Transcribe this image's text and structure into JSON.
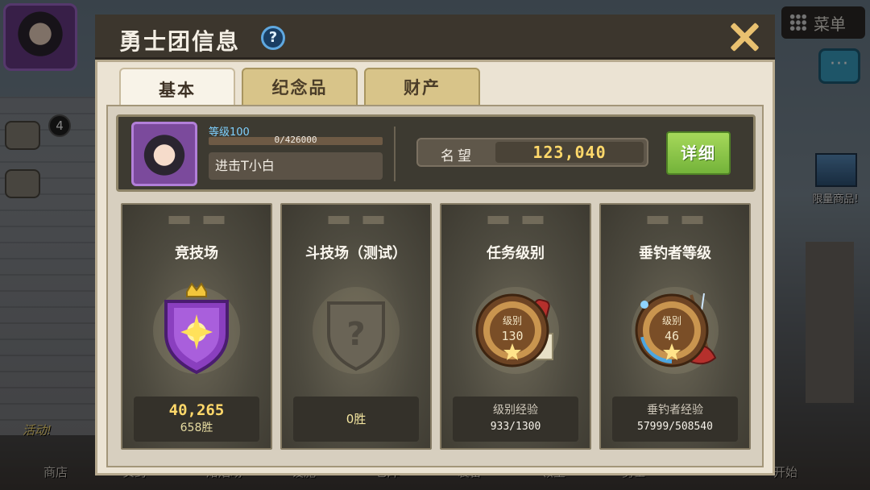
{
  "background": {
    "menu_label": "菜单",
    "shop_label": "限量商品!",
    "event_label": "活动!",
    "badge_count": "4",
    "dock": [
      "商店",
      "实药",
      "熔焰场",
      "设施",
      "仓库",
      "装备",
      "领主",
      "勇士",
      "开始"
    ]
  },
  "dialog": {
    "title": "勇士团信息",
    "help_icon": "?",
    "tabs": [
      {
        "label": "基本",
        "active": true
      },
      {
        "label": "纪念品",
        "active": false
      },
      {
        "label": "财产",
        "active": false
      }
    ]
  },
  "profile": {
    "level_label": "等级100",
    "xp_text": "0/426000",
    "xp_progress": 0,
    "name": "进击T小白",
    "fame_label": "名望",
    "fame_value": "123,040",
    "detail_button": "详细"
  },
  "cards": [
    {
      "title": "竞技场",
      "icon": "purple-shield-crown-icon",
      "main": "40,265",
      "sub": "658胜"
    },
    {
      "title": "斗技场（测试）",
      "icon": "locked-shield-question-icon",
      "center": "0胜"
    },
    {
      "title": "任务级别",
      "icon": "quest-level-medal-icon",
      "medal_label": "级别",
      "medal_value": "130",
      "stat_label": "级别经验",
      "stat_value": "933/1300"
    },
    {
      "title": "垂钓者等级",
      "icon": "angler-level-medal-icon",
      "medal_label": "级别",
      "medal_value": "46",
      "stat_label": "垂钓者经验",
      "stat_value": "57999/508540"
    }
  ],
  "colors": {
    "gold_text": "#ffd86a",
    "level_blue": "#7fd1ff",
    "detail_green": "#8cc84b",
    "tab_active": "#f8f3e8",
    "tab_inactive": "#d8c489"
  }
}
